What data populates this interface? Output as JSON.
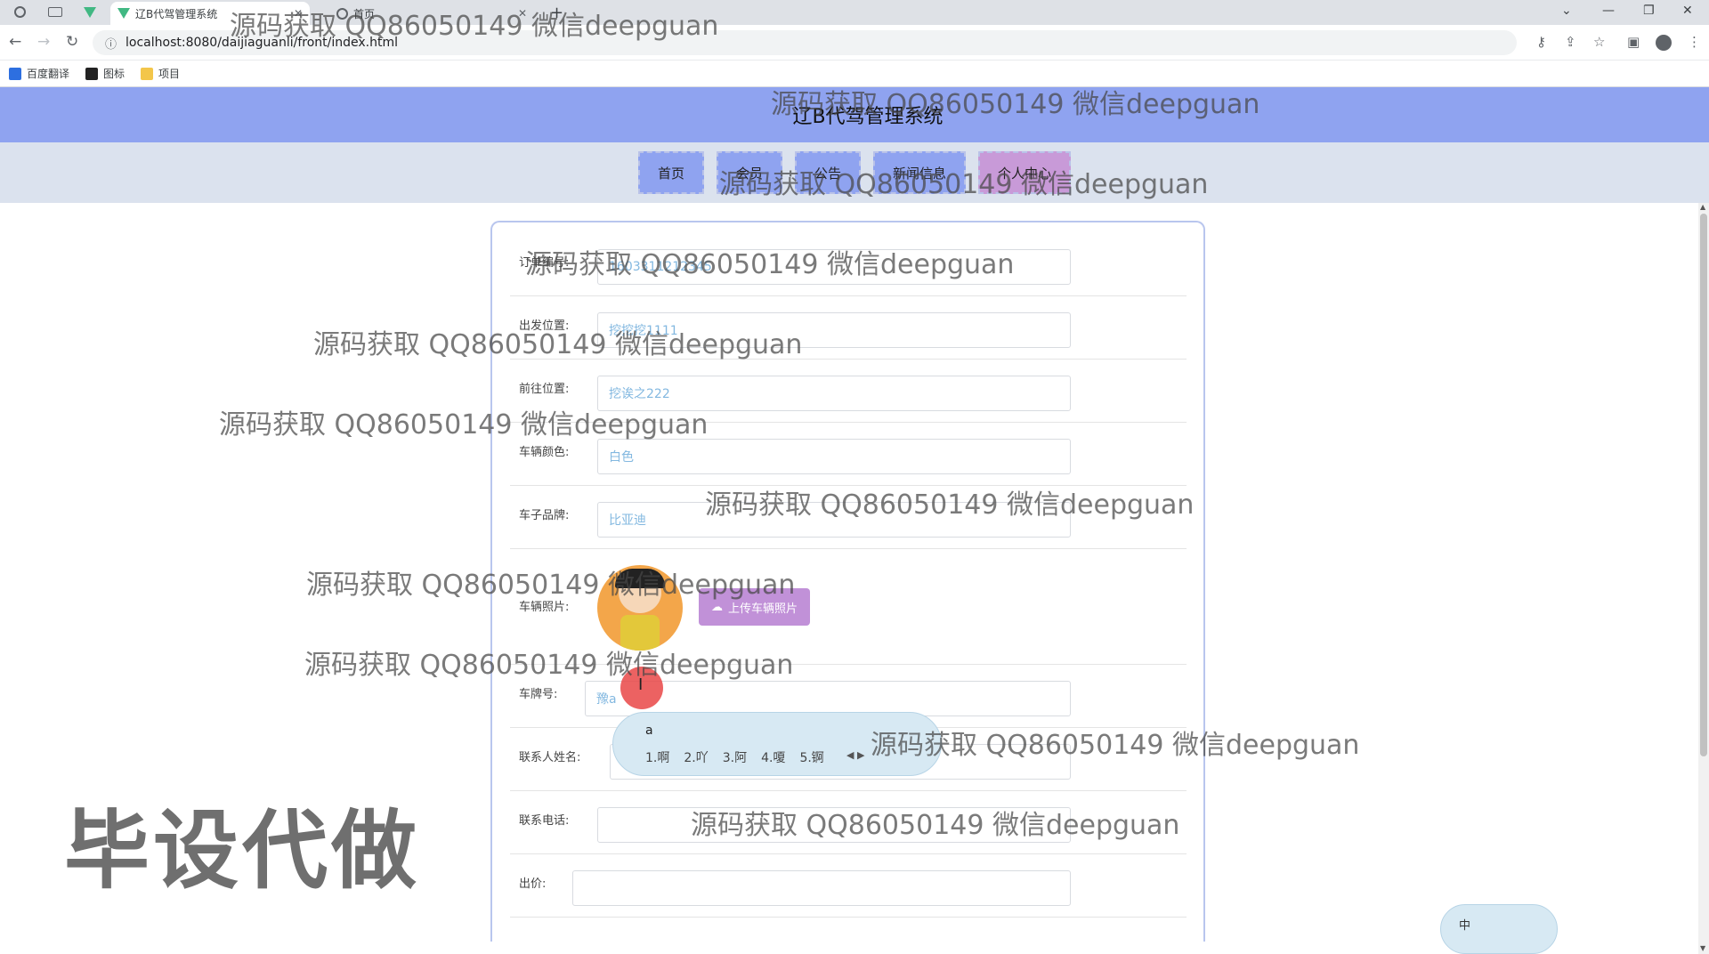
{
  "browser": {
    "tabs": [
      {
        "title": "辽B代驾管理系统",
        "icon": "vue-logo-icon"
      },
      {
        "title": "首页",
        "icon": "globe-icon"
      }
    ],
    "new_tab_symbol": "+",
    "url": "localhost:8080/daijiaguanli/front/index.html",
    "bookmarks": [
      {
        "label": "百度翻译",
        "color": "#2d6fe0"
      },
      {
        "label": "图标",
        "color": "#222222"
      },
      {
        "label": "项目",
        "color": "#f3c64a"
      }
    ]
  },
  "site": {
    "title": "辽B代驾管理系统",
    "nav": [
      "首页",
      "会员",
      "公告",
      "新闻信息",
      "个人中心"
    ]
  },
  "form": {
    "fields": [
      {
        "label": "订单编号:",
        "value": "1603311212345"
      },
      {
        "label": "出发位置:",
        "value": "挖挖挖1111"
      },
      {
        "label": "前往位置:",
        "value": "挖诶之222"
      },
      {
        "label": "车辆颜色:",
        "value": "白色"
      },
      {
        "label": "车子品牌:",
        "value": "比亚迪"
      }
    ],
    "photo": {
      "label": "车辆照片:",
      "upload_label": "上传车辆照片",
      "upload_icon": "cloud-upload-icon"
    },
    "plate": {
      "label": "车牌号:",
      "value": "豫a"
    },
    "contact_name": {
      "label": "联系人姓名:",
      "value": ""
    },
    "contact_phone": {
      "label": "联系电话:",
      "value": ""
    },
    "price": {
      "label": "出价:",
      "value": ""
    }
  },
  "ime": {
    "composition": "a",
    "candidates": [
      "1.啊",
      "2.吖",
      "3.阿",
      "4.嗄",
      "5.锕"
    ],
    "mode": "中"
  },
  "watermarks": {
    "text": "源码获取 QQ86050149 微信deepguan",
    "big": "毕设代做"
  }
}
